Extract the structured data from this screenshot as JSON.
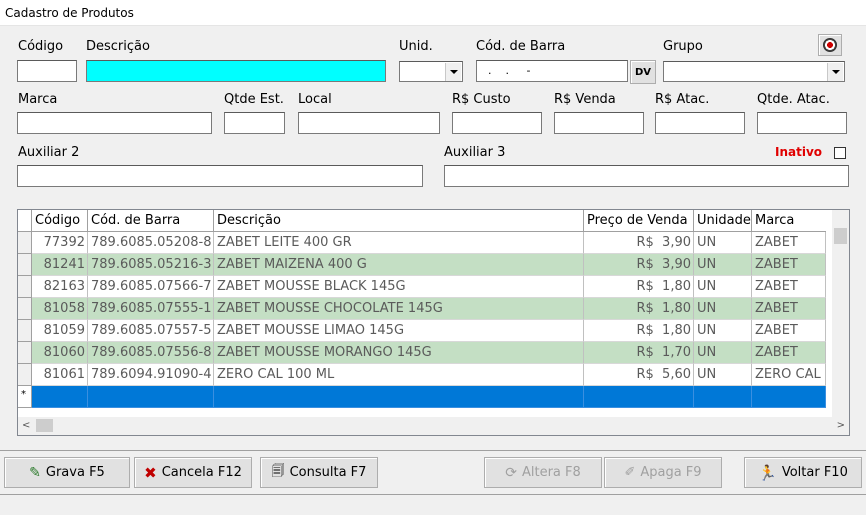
{
  "window": {
    "title": "Cadastro de Produtos"
  },
  "form": {
    "codigo_label": "Código",
    "descricao_label": "Descrição",
    "unid_label": "Unid.",
    "cod_barra_label": "Cód. de Barra",
    "cod_barra_value": "  .    .     -",
    "dv_label": "DV",
    "grupo_label": "Grupo",
    "marca_label": "Marca",
    "qtde_est_label": "Qtde Est.",
    "local_label": "Local",
    "custo_label": "R$ Custo",
    "venda_label": "R$ Venda",
    "atac_label": "R$ Atac.",
    "qtde_atac_label": "Qtde. Atac.",
    "aux2_label": "Auxiliar 2",
    "aux3_label": "Auxiliar 3",
    "inativo_label": "Inativo"
  },
  "grid": {
    "columns": [
      "Código",
      "Cód. de Barra",
      "Descrição",
      "Preço de Venda",
      "Unidade",
      "Marca"
    ],
    "rows": [
      {
        "codigo": "77392",
        "barra": "789.6085.05208-8",
        "descricao": "ZABET LEITE 400 GR",
        "preco": "R$  3,90",
        "unidade": "UN",
        "marca": "ZABET"
      },
      {
        "codigo": "81241",
        "barra": "789.6085.05216-3",
        "descricao": "ZABET MAIZENA 400 G",
        "preco": "R$  3,90",
        "unidade": "UN",
        "marca": "ZABET"
      },
      {
        "codigo": "82163",
        "barra": "789.6085.07566-7",
        "descricao": "ZABET MOUSSE BLACK 145G",
        "preco": "R$  1,80",
        "unidade": "UN",
        "marca": "ZABET"
      },
      {
        "codigo": "81058",
        "barra": "789.6085.07555-1",
        "descricao": "ZABET MOUSSE CHOCOLATE 145G",
        "preco": "R$  1,80",
        "unidade": "UN",
        "marca": "ZABET"
      },
      {
        "codigo": "81059",
        "barra": "789.6085.07557-5",
        "descricao": "ZABET MOUSSE LIMAO 145G",
        "preco": "R$  1,80",
        "unidade": "UN",
        "marca": "ZABET"
      },
      {
        "codigo": "81060",
        "barra": "789.6085.07556-8",
        "descricao": "ZABET MOUSSE MORANGO 145G",
        "preco": "R$  1,70",
        "unidade": "UN",
        "marca": "ZABET"
      },
      {
        "codigo": "81061",
        "barra": "789.6094.91090-4",
        "descricao": "ZERO CAL 100 ML",
        "preco": "R$  5,60",
        "unidade": "UN",
        "marca": "ZERO CAL"
      }
    ],
    "new_row_marker": "*",
    "colors": {
      "alt_row": "#c4dfc4",
      "selected_row": "#0078d7",
      "cyan_field": "#00ffff"
    }
  },
  "toolbar": {
    "grava": "Grava F5",
    "cancela": "Cancela F12",
    "consulta": "Consulta F7",
    "altera": "Altera F8",
    "apaga": "Apaga F9",
    "voltar": "Voltar F10"
  }
}
